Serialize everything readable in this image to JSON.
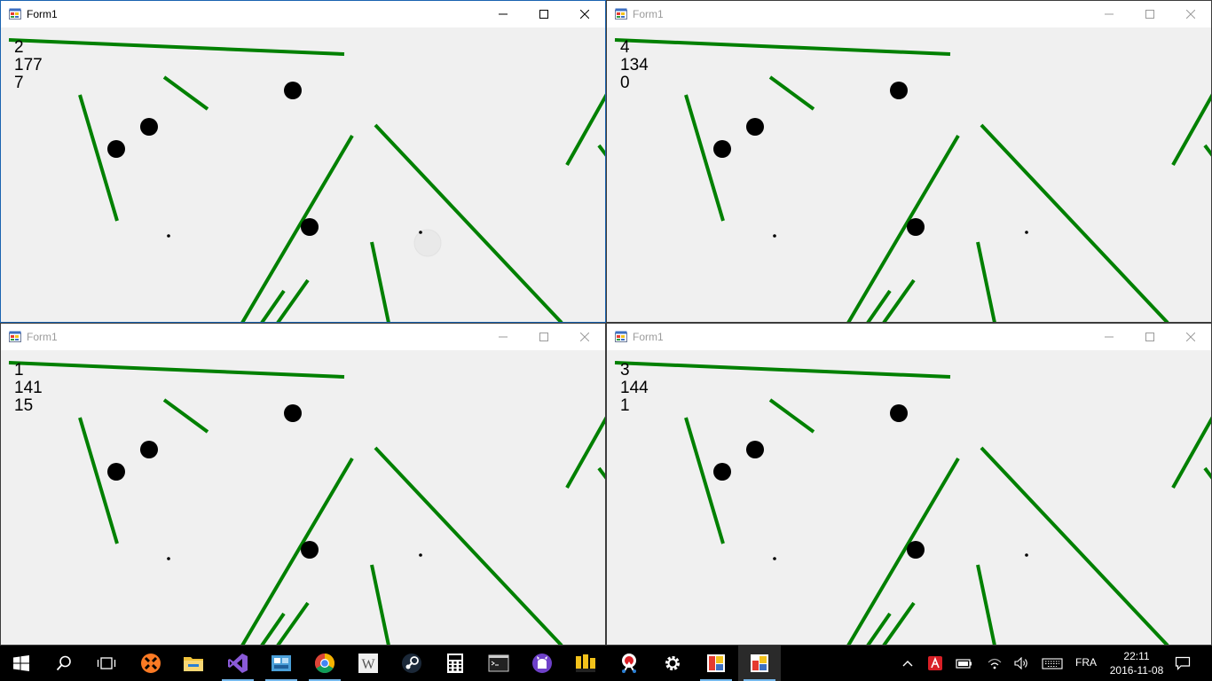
{
  "windows": [
    {
      "title": "Form1",
      "stats": [
        "2",
        "177",
        "7"
      ],
      "active": true
    },
    {
      "title": "Form1",
      "stats": [
        "4",
        "134",
        "0"
      ],
      "active": false
    },
    {
      "title": "Form1",
      "stats": [
        "1",
        "141",
        "15"
      ],
      "active": false
    },
    {
      "title": "Form1",
      "stats": [
        "3",
        "144",
        "1"
      ],
      "active": false
    }
  ],
  "colors": {
    "wall": "#008000",
    "ball": "#000000",
    "background": "#f0f0f0",
    "active_border": "#1a63b0"
  },
  "taskbar": {
    "items": [
      "start-icon",
      "search-icon",
      "task-view-icon",
      "xampp-icon",
      "file-explorer-icon",
      "visual-studio-icon",
      "app-icon",
      "chrome-icon",
      "word-icon",
      "steam-icon",
      "calculator-icon",
      "command-prompt-icon",
      "github-icon",
      "paint-icon",
      "snipping-tool-icon",
      "settings-icon",
      "form-app-icon",
      "form-app-icon-active"
    ],
    "tray": [
      "chevron-up-icon",
      "avira-icon",
      "battery-icon",
      "wifi-icon",
      "volume-icon",
      "keyboard-icon"
    ],
    "language": "FRA",
    "time": "22:11",
    "date": "2016-11-08"
  }
}
